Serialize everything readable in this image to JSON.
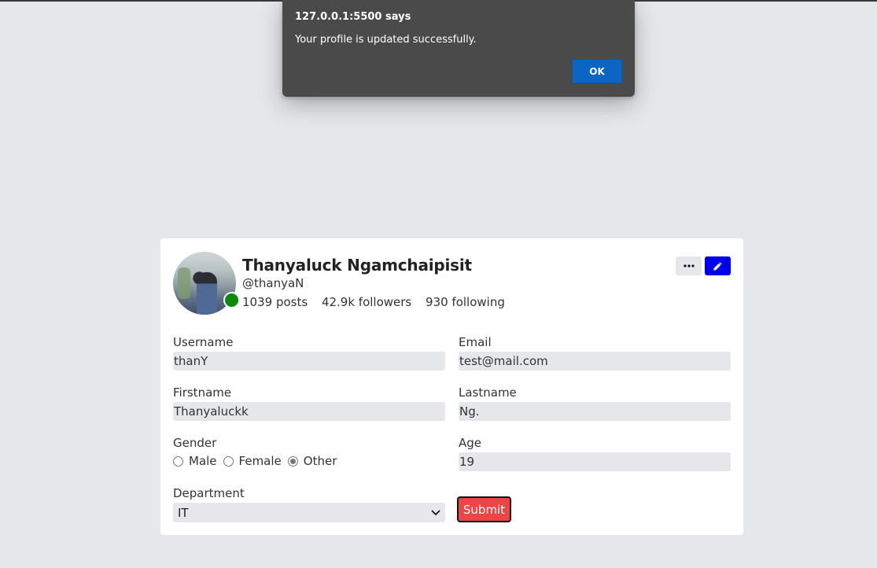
{
  "dialog": {
    "origin": "127.0.0.1:5500 says",
    "message": "Your profile is updated successfully.",
    "ok_label": "OK",
    "ok_color": "#0a66c2"
  },
  "profile": {
    "name": "Thanyaluck Ngamchaipisit",
    "handle": "@thanyaN",
    "posts": "1039 posts",
    "followers": "42.9k followers",
    "following": "930 following",
    "status": "online",
    "status_color": "#0a8a0a"
  },
  "actions": {
    "more_icon": "ellipsis-icon",
    "edit_icon": "pencil-icon",
    "edit_color": "#0000ee"
  },
  "form": {
    "username": {
      "label": "Username",
      "value": "thanY"
    },
    "email": {
      "label": "Email",
      "value": "test@mail.com"
    },
    "firstname": {
      "label": "Firstname",
      "value": "Thanyaluckk"
    },
    "lastname": {
      "label": "Lastname",
      "value": "Ng."
    },
    "gender": {
      "label": "Gender",
      "options": [
        "Male",
        "Female",
        "Other"
      ],
      "selected": "Other"
    },
    "age": {
      "label": "Age",
      "value": "19"
    },
    "department": {
      "label": "Department",
      "selected": "IT"
    },
    "submit_label": "Submit",
    "submit_color": "#ef4444"
  }
}
